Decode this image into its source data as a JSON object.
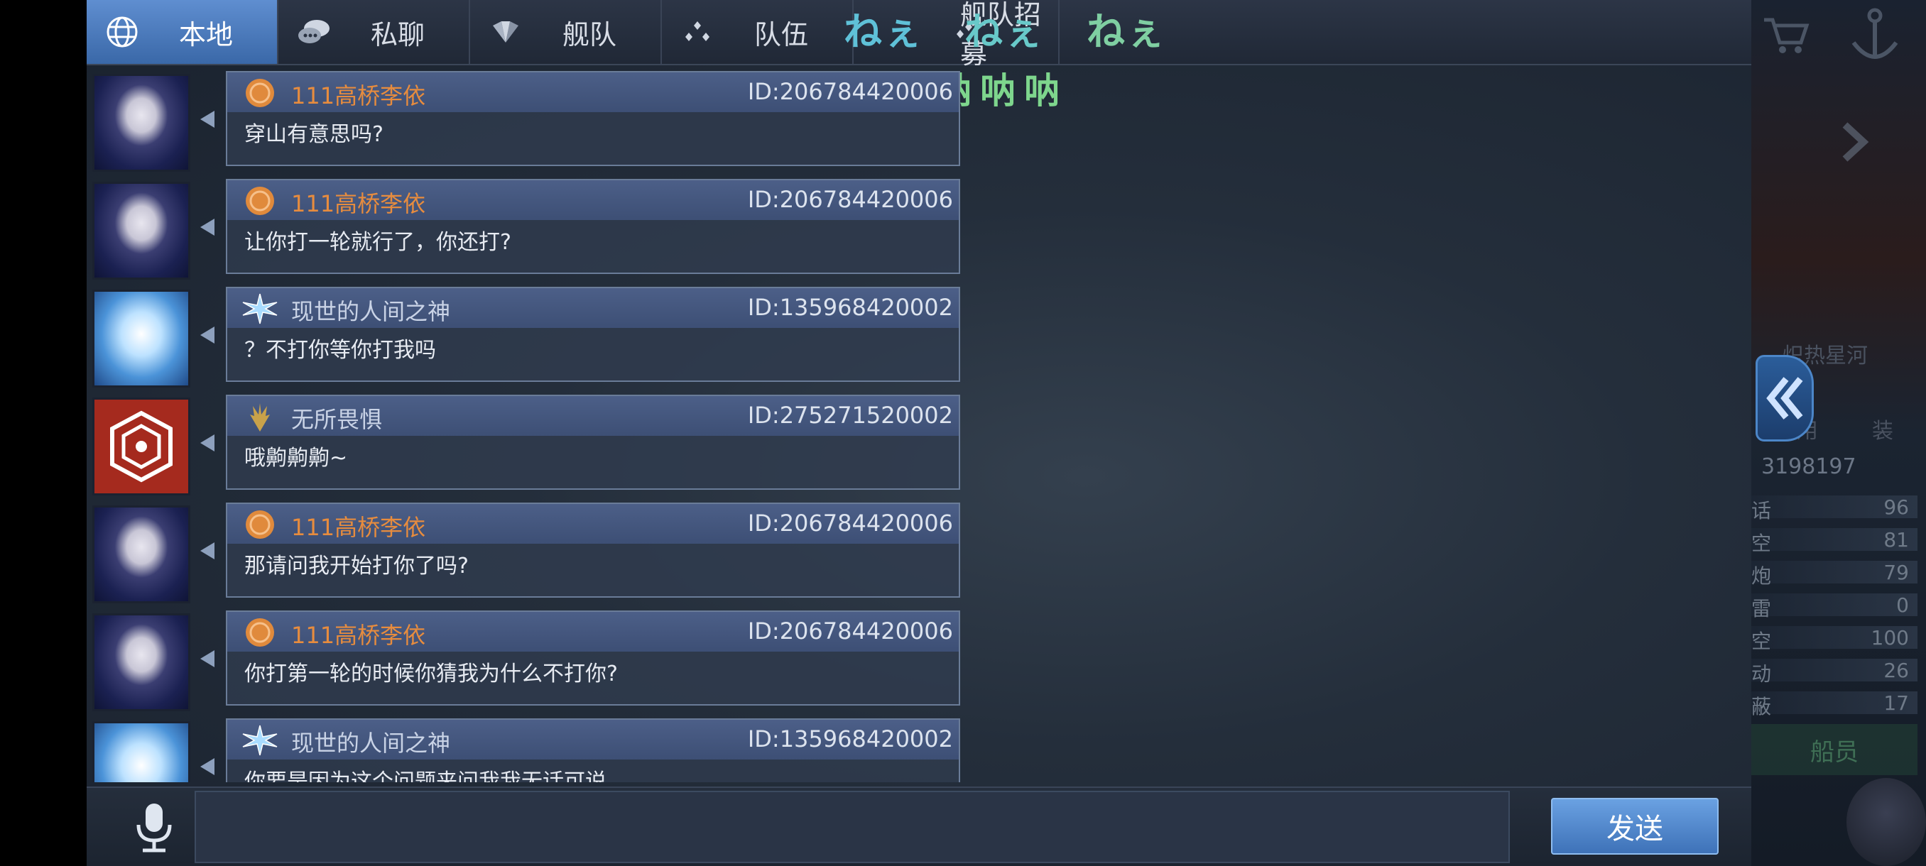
{
  "tabs": [
    {
      "label": "本地",
      "icon": "globe-icon",
      "active": true
    },
    {
      "label": "私聊",
      "icon": "chat-bubbles-icon",
      "active": false
    },
    {
      "label": "舰队",
      "icon": "fleet-shield-icon",
      "active": false
    },
    {
      "label": "队伍",
      "icon": "team-dots-icon",
      "active": false
    },
    {
      "label": "舰队招募",
      "icon": "recruit-icon",
      "active": false
    }
  ],
  "overlay": {
    "kana": [
      "ねぇ",
      "ねぇ",
      "ねぇ"
    ],
    "sub": "呐呐呐"
  },
  "messages": [
    {
      "sender": "111高桥李依",
      "id": "ID:206784420006",
      "text": "穿山有意思吗?",
      "avatar": "girl-avatar",
      "rank_icon": "orange-medal-icon",
      "sender_color": "#e78c3e"
    },
    {
      "sender": "111高桥李依",
      "id": "ID:206784420006",
      "text": "让你打一轮就行了，你还打?",
      "avatar": "girl-avatar",
      "rank_icon": "orange-medal-icon",
      "sender_color": "#e78c3e"
    },
    {
      "sender": "现世的人间之神",
      "id": "ID:135968420002",
      "text": "？不打你等你打我吗",
      "avatar": "angel-avatar",
      "rank_icon": "ice-crystal-icon",
      "sender_color": "#c9d3e6"
    },
    {
      "sender": "无所畏惧",
      "id": "ID:275271520002",
      "text": "哦齁齁齁~",
      "avatar": "emblem-avatar",
      "rank_icon": "gold-wings-icon",
      "sender_color": "#c9d3e6"
    },
    {
      "sender": "111高桥李依",
      "id": "ID:206784420006",
      "text": "那请问我开始打你了吗?",
      "avatar": "girl-avatar",
      "rank_icon": "orange-medal-icon",
      "sender_color": "#e78c3e"
    },
    {
      "sender": "111高桥李依",
      "id": "ID:206784420006",
      "text": "你打第一轮的时候你猜我为什么不打你?",
      "avatar": "girl-avatar",
      "rank_icon": "orange-medal-icon",
      "sender_color": "#e78c3e"
    },
    {
      "sender": "现世的人间之神",
      "id": "ID:135968420002",
      "text": "你要是因为这个问题来问我我无话可说",
      "avatar": "angel-avatar",
      "rank_icon": "ice-crystal-icon",
      "sender_color": "#c9d3e6"
    }
  ],
  "input": {
    "value": "",
    "placeholder": "",
    "send_label": "发送"
  },
  "background_panel": {
    "ship_name": "炽热星河",
    "power": "3198197",
    "stats": [
      "96",
      "81",
      "79",
      "0",
      "100",
      "26",
      "17"
    ],
    "crew_label": "船员",
    "partial_labels": [
      "用",
      "装",
      "话",
      "空",
      "炮",
      "雷",
      "空",
      "动",
      "蔽"
    ]
  },
  "colors": {
    "accent": "#3e72b8",
    "active_tab": "#4f7fc2",
    "sender_orange": "#e78c3e",
    "kana_cyan": "#5fc1d8",
    "kana_green": "#7ed68d"
  }
}
